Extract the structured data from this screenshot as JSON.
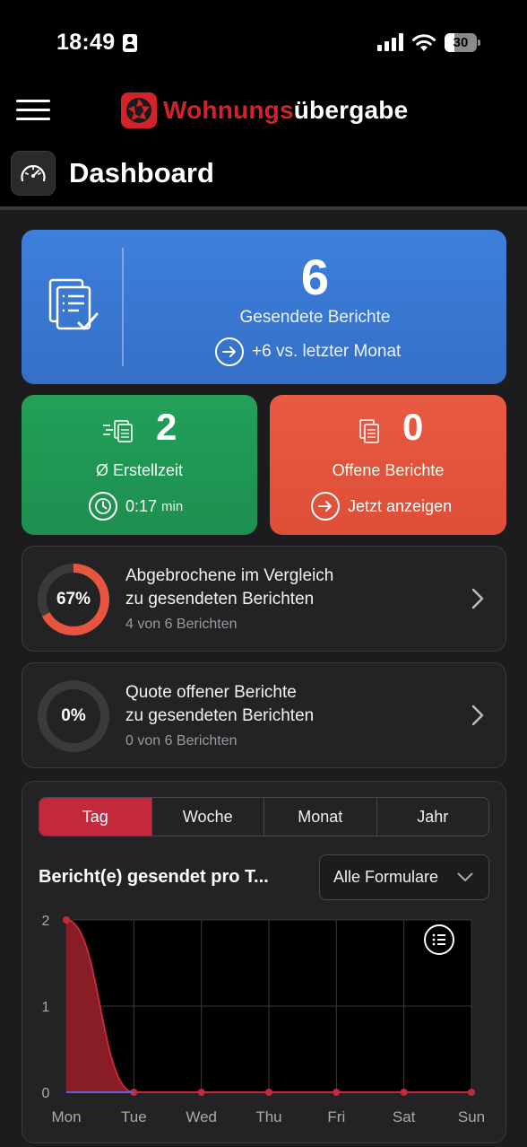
{
  "status_bar": {
    "time": "18:49",
    "battery": "30",
    "battery_level": 0.3
  },
  "header": {
    "brand_part1": "Wohnungs",
    "brand_part2": "übergabe",
    "page_title": "Dashboard"
  },
  "sent_reports": {
    "count": "6",
    "label": "Gesendete Berichte",
    "trend": "+6 vs. letzter Monat"
  },
  "avg_time": {
    "count": "2",
    "label": "Ø Erstellzeit",
    "time": "0:17",
    "unit": "min"
  },
  "open_reports": {
    "count": "0",
    "label": "Offene Berichte",
    "action": "Jetzt anzeigen"
  },
  "ratios": [
    {
      "percent": "67%",
      "value": 0.67,
      "line1": "Abgebrochene im Vergleich",
      "line2": "zu gesendeten Berichten",
      "sub": "4 von 6 Berichten"
    },
    {
      "percent": "0%",
      "value": 0,
      "line1": "Quote offener Berichte",
      "line2": "zu gesendeten Berichten",
      "sub": "0 von 6 Berichten"
    }
  ],
  "periods": [
    "Tag",
    "Woche",
    "Monat",
    "Jahr"
  ],
  "active_period": "Tag",
  "chart_section": {
    "title": "Bericht(e) gesendet pro T...",
    "filter": "Alle Formulare",
    "legend_icon": "list-icon"
  },
  "colors": {
    "brand_red": "#d2232a",
    "blue_card": "#3d80dc",
    "green_card": "#22a05a",
    "red_card": "#e85a42",
    "ring_accent": "#e8553f",
    "series_line": "#c5283a",
    "series_fill": "#8f1f28"
  },
  "chart_data": {
    "type": "area",
    "categories": [
      "Mon",
      "Tue",
      "Wed",
      "Thu",
      "Fri",
      "Sat",
      "Sun"
    ],
    "series": [
      {
        "values": [
          2,
          0,
          0,
          0,
          0,
          0,
          0
        ]
      }
    ],
    "yticks": [
      "0",
      "1",
      "2"
    ],
    "ylim": [
      0,
      2
    ],
    "grid": true,
    "legend": "top-right",
    "title": "",
    "xlabel": "",
    "ylabel": ""
  }
}
